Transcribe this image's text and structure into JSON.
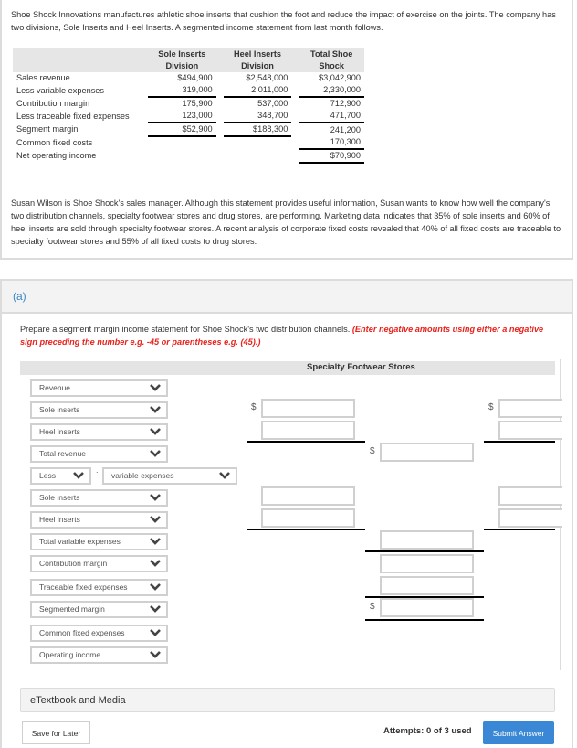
{
  "problem": {
    "intro": "Shoe Shock Innovations manufactures athletic shoe inserts that cushion the foot and reduce the impact of exercise on the joints. The company has two divisions, Sole Inserts and Heel Inserts. A segmented income statement from last month follows.",
    "table": {
      "headers": [
        [
          "Sole Inserts",
          "Division"
        ],
        [
          "Heel Inserts",
          "Division"
        ],
        [
          "Total Shoe",
          "Shock"
        ]
      ],
      "rows": [
        {
          "label": "Sales revenue",
          "values": [
            "$494,900",
            "$2,548,000",
            "$3,042,900"
          ]
        },
        {
          "label": "Less variable expenses",
          "values": [
            "319,000",
            "2,011,000",
            "2,330,000"
          ]
        },
        {
          "label": "Contribution margin",
          "values": [
            "175,900",
            "537,000",
            "712,900"
          ]
        },
        {
          "label": "Less traceable fixed expenses",
          "values": [
            "123,000",
            "348,700",
            "471,700"
          ]
        },
        {
          "label": "Segment margin",
          "values": [
            "$52,900",
            "$188,300",
            "241,200"
          ]
        },
        {
          "label": "Common fixed costs",
          "values": [
            "",
            "",
            "170,300"
          ]
        },
        {
          "label": "Net operating income",
          "values": [
            "",
            "",
            "$70,900"
          ]
        }
      ]
    },
    "statement": "Susan Wilson is Shoe Shock's sales manager. Although this statement provides useful information, Susan wants to know how well the company's two distribution channels, specialty footwear stores and drug stores, are performing. Marketing data indicates that 35% of sole inserts and 60% of heel inserts are sold through specialty footwear stores. A recent analysis of corporate fixed costs revealed that 40% of all fixed costs are traceable to specialty footwear stores and 55% of all fixed costs to drug stores."
  },
  "part": {
    "label": "(a)",
    "instructions": "Prepare a segment margin income statement for Shoe Shock's two distribution channels.",
    "warning": "(Enter negative amounts using either a negative sign preceding the number e.g. -45 or parentheses e.g. (45).)",
    "column_title": "Specialty Footwear Stores",
    "selects": {
      "revenue": "Revenue",
      "sole_inserts_1": "Sole inserts",
      "heel_inserts_1": "Heel inserts",
      "total_revenue": "Total revenue",
      "less": "Less",
      "colon": ":",
      "variable_expenses": "variable expenses",
      "sole_inserts_2": "Sole inserts",
      "heel_inserts_2": "Heel inserts",
      "total_variable_expenses": "Total variable expenses",
      "contribution_margin": "Contribution margin",
      "traceable_fixed_expenses": "Traceable fixed expenses",
      "segmented_margin": "Segmented margin",
      "common_fixed_expenses": "Common fixed expenses",
      "operating_income": "Operating income"
    },
    "currency_symbol": "$",
    "inputs": {
      "sole_inserts_rev": "",
      "heel_inserts_rev": "",
      "total_revenue": "",
      "sole_inserts_var": "",
      "heel_inserts_var": "",
      "total_variable": "",
      "contribution_margin": "",
      "traceable_fixed": "",
      "segmented_margin": "",
      "drug_sole_rev": "",
      "drug_heel_rev": "",
      "drug_sole_var": "",
      "drug_heel_var": ""
    }
  },
  "footer": {
    "etextbook": "eTextbook and Media",
    "save_label": "Save for Later",
    "attempts": "Attempts: 0 of 3 used",
    "submit_label": "Submit Answer"
  },
  "colors": {
    "accent": "#3a87d5",
    "part_label": "#3a87c8",
    "warning": "#e8221c"
  }
}
